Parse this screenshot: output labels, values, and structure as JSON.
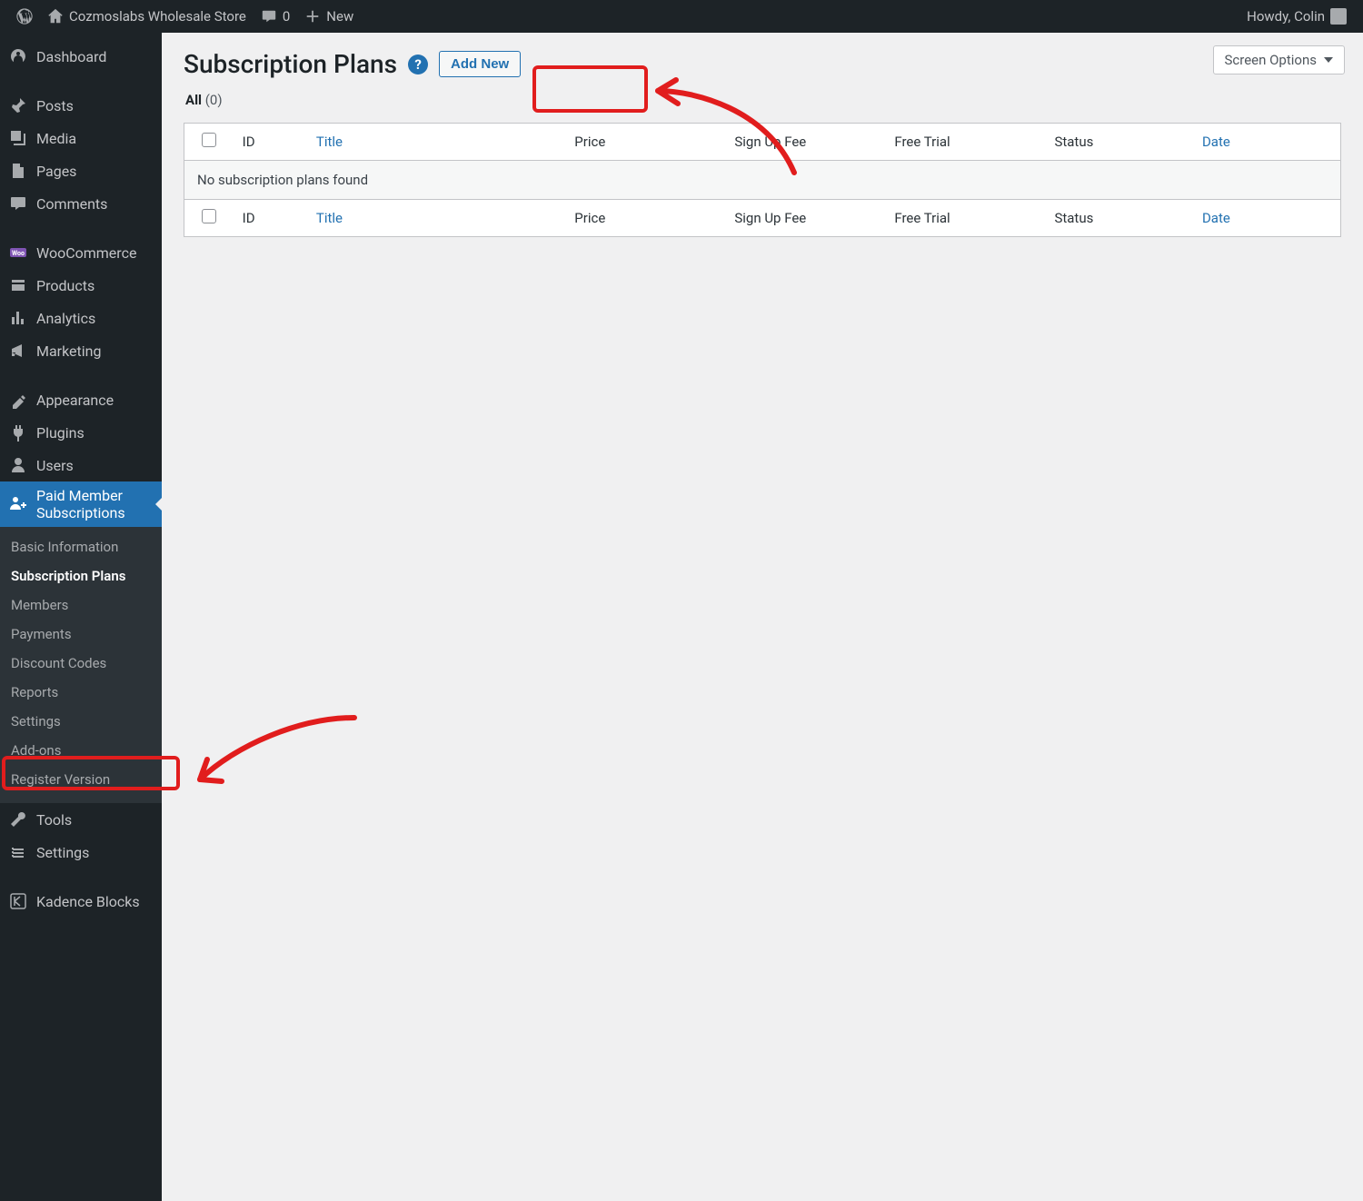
{
  "adminbar": {
    "site_name": "Cozmoslabs Wholesale Store",
    "comments_count": "0",
    "new_label": "New",
    "howdy": "Howdy, Colin"
  },
  "sidebar": {
    "items": [
      {
        "id": "dashboard",
        "label": "Dashboard"
      },
      {
        "id": "posts",
        "label": "Posts"
      },
      {
        "id": "media",
        "label": "Media"
      },
      {
        "id": "pages",
        "label": "Pages"
      },
      {
        "id": "comments",
        "label": "Comments"
      },
      {
        "id": "woocommerce",
        "label": "WooCommerce"
      },
      {
        "id": "products",
        "label": "Products"
      },
      {
        "id": "analytics",
        "label": "Analytics"
      },
      {
        "id": "marketing",
        "label": "Marketing"
      },
      {
        "id": "appearance",
        "label": "Appearance"
      },
      {
        "id": "plugins",
        "label": "Plugins"
      },
      {
        "id": "users",
        "label": "Users"
      },
      {
        "id": "pms",
        "label": "Paid Member Subscriptions"
      },
      {
        "id": "tools",
        "label": "Tools"
      },
      {
        "id": "settings",
        "label": "Settings"
      },
      {
        "id": "kadence",
        "label": "Kadence Blocks"
      }
    ],
    "submenu": [
      {
        "id": "basic-info",
        "label": "Basic Information"
      },
      {
        "id": "subscription-plans",
        "label": "Subscription Plans"
      },
      {
        "id": "members",
        "label": "Members"
      },
      {
        "id": "payments",
        "label": "Payments"
      },
      {
        "id": "discount-codes",
        "label": "Discount Codes"
      },
      {
        "id": "reports",
        "label": "Reports"
      },
      {
        "id": "settings",
        "label": "Settings"
      },
      {
        "id": "addons",
        "label": "Add-ons"
      },
      {
        "id": "register-version",
        "label": "Register Version"
      }
    ]
  },
  "page": {
    "screen_options": "Screen Options",
    "title": "Subscription Plans",
    "add_new": "Add New",
    "filter_all": "All",
    "filter_count": "(0)"
  },
  "table": {
    "columns": {
      "id": "ID",
      "title": "Title",
      "price": "Price",
      "signup": "Sign Up Fee",
      "trial": "Free Trial",
      "status": "Status",
      "date": "Date"
    },
    "empty_message": "No subscription plans found"
  },
  "colors": {
    "accent": "#2271b1",
    "annotation": "#e11d1d"
  }
}
